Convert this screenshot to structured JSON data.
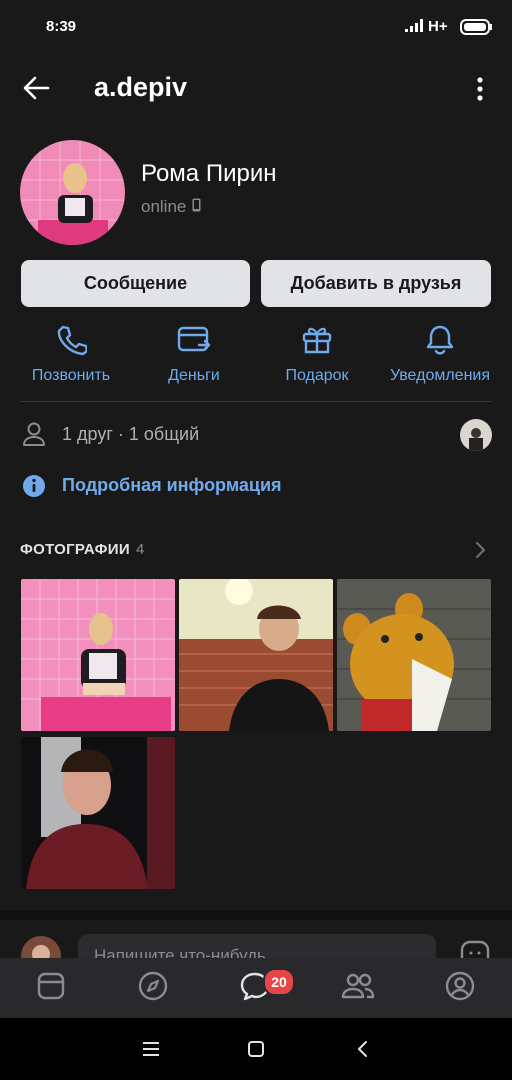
{
  "status_bar": {
    "time": "8:39",
    "network": "H+"
  },
  "header": {
    "title": "a.depiv"
  },
  "profile": {
    "name": "Рома Пирин",
    "status": "online"
  },
  "buttons": {
    "message": "Сообщение",
    "add_friend": "Добавить в друзья"
  },
  "actions": [
    {
      "label": "Позвонить",
      "icon": "phone-icon"
    },
    {
      "label": "Деньги",
      "icon": "money-card-icon"
    },
    {
      "label": "Подарок",
      "icon": "gift-icon"
    },
    {
      "label": "Уведомления",
      "icon": "bell-icon"
    }
  ],
  "friends_row": {
    "text": "1 друг · 1 общий"
  },
  "info_row": {
    "text": "Подробная информация"
  },
  "photos": {
    "title": "ФОТОГРАФИИ",
    "count": "4"
  },
  "composer": {
    "placeholder": "Напишите что-нибудь..."
  },
  "tabs": [
    {
      "icon": "news-icon"
    },
    {
      "icon": "discover-icon"
    },
    {
      "icon": "messages-icon",
      "badge": "20"
    },
    {
      "icon": "friends-icon"
    },
    {
      "icon": "profile-icon"
    }
  ],
  "colors": {
    "background": "#19191a",
    "accent": "#71aaeb",
    "badge": "#e64646"
  }
}
